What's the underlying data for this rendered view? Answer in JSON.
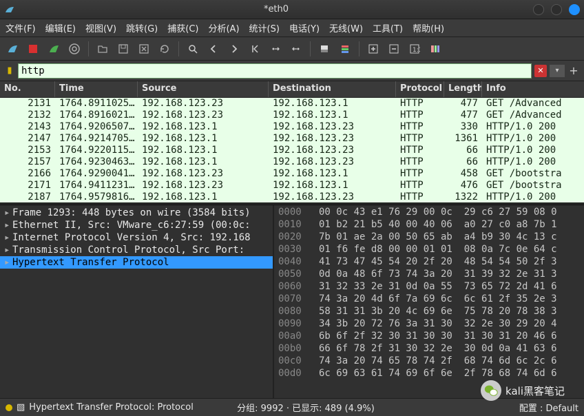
{
  "window": {
    "title": "*eth0"
  },
  "menu": {
    "file": "文件(F)",
    "edit": "编辑(E)",
    "view": "视图(V)",
    "go": "跳转(G)",
    "capture": "捕获(C)",
    "analyze": "分析(A)",
    "statistics": "统计(S)",
    "telephony": "电话(Y)",
    "wireless": "无线(W)",
    "tools": "工具(T)",
    "help": "帮助(H)"
  },
  "filter": {
    "value": "http"
  },
  "columns": {
    "no": "No.",
    "time": "Time",
    "source": "Source",
    "destination": "Destination",
    "protocol": "Protocol",
    "length": "Length",
    "info": "Info"
  },
  "packets": [
    {
      "no": "2131",
      "time": "1764.8911025…",
      "src": "192.168.123.23",
      "dst": "192.168.123.1",
      "proto": "HTTP",
      "len": "477",
      "info": "GET /Advanced"
    },
    {
      "no": "2132",
      "time": "1764.8916021…",
      "src": "192.168.123.23",
      "dst": "192.168.123.1",
      "proto": "HTTP",
      "len": "477",
      "info": "GET /Advanced"
    },
    {
      "no": "2143",
      "time": "1764.9206507…",
      "src": "192.168.123.1",
      "dst": "192.168.123.23",
      "proto": "HTTP",
      "len": "330",
      "info": "HTTP/1.0 200"
    },
    {
      "no": "2147",
      "time": "1764.9214705…",
      "src": "192.168.123.1",
      "dst": "192.168.123.23",
      "proto": "HTTP",
      "len": "1361",
      "info": "HTTP/1.0 200"
    },
    {
      "no": "2153",
      "time": "1764.9220115…",
      "src": "192.168.123.1",
      "dst": "192.168.123.23",
      "proto": "HTTP",
      "len": "66",
      "info": "HTTP/1.0 200"
    },
    {
      "no": "2157",
      "time": "1764.9230463…",
      "src": "192.168.123.1",
      "dst": "192.168.123.23",
      "proto": "HTTP",
      "len": "66",
      "info": "HTTP/1.0 200"
    },
    {
      "no": "2166",
      "time": "1764.9290041…",
      "src": "192.168.123.23",
      "dst": "192.168.123.1",
      "proto": "HTTP",
      "len": "458",
      "info": "GET /bootstra"
    },
    {
      "no": "2171",
      "time": "1764.9411231…",
      "src": "192.168.123.23",
      "dst": "192.168.123.1",
      "proto": "HTTP",
      "len": "476",
      "info": "GET /bootstra"
    },
    {
      "no": "2187",
      "time": "1764.9579816…",
      "src": "192.168.123.1",
      "dst": "192.168.123.23",
      "proto": "HTTP",
      "len": "1322",
      "info": "HTTP/1.0 200"
    }
  ],
  "tree": {
    "frame": "Frame 1293: 448 bytes on wire (3584 bits)",
    "eth": "Ethernet II, Src: VMware_c6:27:59 (00:0c:",
    "ip": "Internet Protocol Version 4, Src: 192.168",
    "tcp": "Transmission Control Protocol, Src Port:",
    "http": "Hypertext Transfer Protocol"
  },
  "hex": [
    {
      "off": "0000",
      "b": "00 0c 43 e1 76 29 00 0c  29 c6 27 59 08 0"
    },
    {
      "off": "0010",
      "b": "01 b2 21 b5 40 00 40 06  a0 27 c0 a8 7b 1"
    },
    {
      "off": "0020",
      "b": "7b 01 ae 2a 00 50 65 ab  a4 b9 30 4c 13 c"
    },
    {
      "off": "0030",
      "b": "01 f6 fe d8 00 00 01 01  08 0a 7c 0e 64 c"
    },
    {
      "off": "0040",
      "b": "41 73 47 45 54 20 2f 20  48 54 54 50 2f 3"
    },
    {
      "off": "0050",
      "b": "0d 0a 48 6f 73 74 3a 20  31 39 32 2e 31 3"
    },
    {
      "off": "0060",
      "b": "31 32 33 2e 31 0d 0a 55  73 65 72 2d 41 6"
    },
    {
      "off": "0070",
      "b": "74 3a 20 4d 6f 7a 69 6c  6c 61 2f 35 2e 3"
    },
    {
      "off": "0080",
      "b": "58 31 31 3b 20 4c 69 6e  75 78 20 78 38 3"
    },
    {
      "off": "0090",
      "b": "34 3b 20 72 76 3a 31 30  32 2e 30 29 20 4"
    },
    {
      "off": "00a0",
      "b": "6b 6f 2f 32 30 31 30 30  31 30 31 20 46 6"
    },
    {
      "off": "00b0",
      "b": "66 6f 78 2f 31 30 32 2e  30 0d 0a 41 63 6"
    },
    {
      "off": "00c0",
      "b": "74 3a 20 74 65 78 74 2f  68 74 6d 6c 2c 6"
    },
    {
      "off": "00d0",
      "b": "6c 69 63 61 74 69 6f 6e  2f 78 68 74 6d 6"
    }
  ],
  "status": {
    "field": "Hypertext Transfer Protocol: Protocol",
    "packets": "分组: 9992 · 已显示: 489 (4.9%)",
    "profile": "配置 : Default"
  },
  "watermark": "kali黑客笔记"
}
